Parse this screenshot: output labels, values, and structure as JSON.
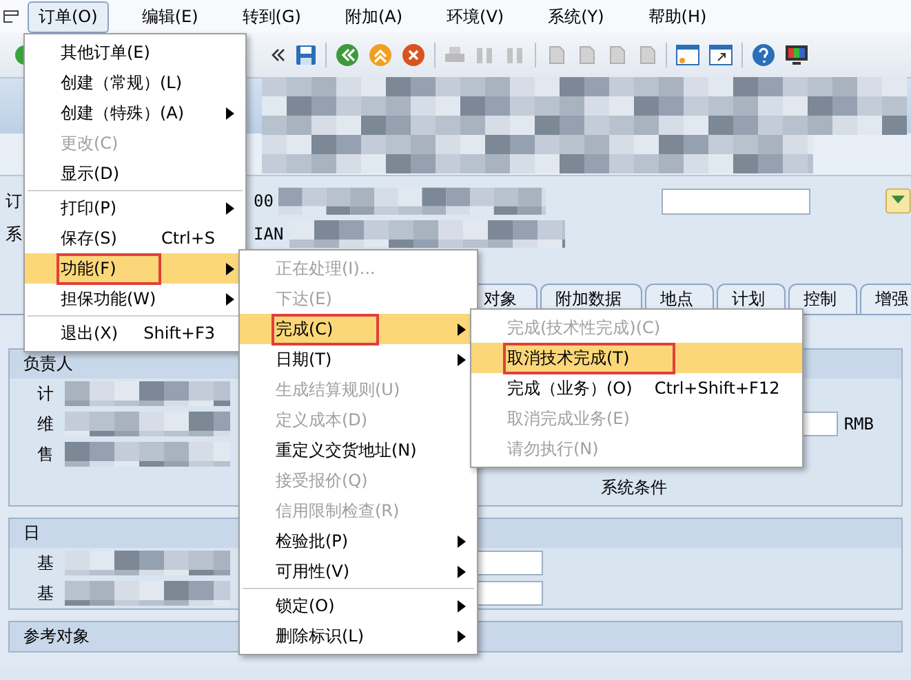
{
  "menubar": [
    {
      "label": "订单(O)",
      "selected": true
    },
    {
      "label": "编辑(E)",
      "selected": false
    },
    {
      "label": "转到(G)",
      "selected": false
    },
    {
      "label": "附加(A)",
      "selected": false
    },
    {
      "label": "环境(V)",
      "selected": false
    },
    {
      "label": "系统(Y)",
      "selected": false
    },
    {
      "label": "帮助(H)",
      "selected": false
    }
  ],
  "header_fields": [
    {
      "label": "订",
      "value": "00"
    },
    {
      "label": "系",
      "value": "IAN"
    }
  ],
  "tabs": [
    {
      "label": "对象",
      "selected": false
    },
    {
      "label": "附加数据",
      "selected": false
    },
    {
      "label": "地点",
      "selected": false
    },
    {
      "label": "计划",
      "selected": false
    },
    {
      "label": "控制",
      "selected": false
    },
    {
      "label": "增强",
      "selected": false
    }
  ],
  "groups": [
    {
      "title": "负责人",
      "rows": [
        "计",
        "维",
        "售"
      ]
    },
    {
      "title": "日",
      "rows": [
        "基",
        "基"
      ]
    },
    {
      "title": "参考对象"
    }
  ],
  "currency": "RMB",
  "status_label": "系统条件",
  "menus": [
    {
      "items": [
        {
          "kind": "item",
          "label": "其他订单(E)",
          "disabled": false,
          "selected": false,
          "submenu": false,
          "marked": false
        },
        {
          "kind": "item",
          "label": "创建（常规）(L)",
          "disabled": false,
          "selected": false,
          "submenu": false,
          "marked": false
        },
        {
          "kind": "item",
          "label": "创建（特殊）(A)",
          "disabled": false,
          "selected": false,
          "submenu": true,
          "marked": false
        },
        {
          "kind": "item",
          "label": "更改(C)",
          "disabled": true,
          "selected": false,
          "submenu": false,
          "marked": false
        },
        {
          "kind": "item",
          "label": "显示(D)",
          "disabled": false,
          "selected": false,
          "submenu": false,
          "marked": false
        },
        {
          "kind": "separator"
        },
        {
          "kind": "item",
          "label": "打印(P)",
          "disabled": false,
          "selected": false,
          "submenu": true,
          "marked": false
        },
        {
          "kind": "item",
          "label": "保存(S)",
          "shortcut": "Ctrl+S",
          "disabled": false,
          "selected": false,
          "submenu": false,
          "marked": false
        },
        {
          "kind": "item",
          "label": "功能(F)",
          "disabled": false,
          "selected": true,
          "submenu": true,
          "marked": true
        },
        {
          "kind": "item",
          "label": "担保功能(W)",
          "disabled": false,
          "selected": false,
          "submenu": true,
          "marked": false
        },
        {
          "kind": "separator"
        },
        {
          "kind": "item",
          "label": "退出(X)",
          "shortcut": "Shift+F3",
          "disabled": false,
          "selected": false,
          "submenu": false,
          "marked": false
        }
      ]
    },
    {
      "items": [
        {
          "kind": "item",
          "label": "正在处理(I)...",
          "disabled": true,
          "selected": false,
          "submenu": false,
          "marked": false
        },
        {
          "kind": "item",
          "label": "下达(E)",
          "disabled": true,
          "selected": false,
          "submenu": false,
          "marked": false
        },
        {
          "kind": "item",
          "label": "完成(C)",
          "disabled": false,
          "selected": true,
          "submenu": true,
          "marked": true
        },
        {
          "kind": "item",
          "label": "日期(T)",
          "disabled": false,
          "selected": false,
          "submenu": true,
          "marked": false
        },
        {
          "kind": "item",
          "label": "生成结算规则(U)",
          "disabled": true,
          "selected": false,
          "submenu": false,
          "marked": false
        },
        {
          "kind": "item",
          "label": "定义成本(D)",
          "disabled": true,
          "selected": false,
          "submenu": false,
          "marked": false
        },
        {
          "kind": "item",
          "label": "重定义交货地址(N)",
          "disabled": false,
          "selected": false,
          "submenu": false,
          "marked": false
        },
        {
          "kind": "item",
          "label": "接受报价(Q)",
          "disabled": true,
          "selected": false,
          "submenu": false,
          "marked": false
        },
        {
          "kind": "item",
          "label": "信用限制检查(R)",
          "disabled": true,
          "selected": false,
          "submenu": false,
          "marked": false
        },
        {
          "kind": "item",
          "label": "检验批(P)",
          "disabled": false,
          "selected": false,
          "submenu": true,
          "marked": false
        },
        {
          "kind": "item",
          "label": "可用性(V)",
          "disabled": false,
          "selected": false,
          "submenu": true,
          "marked": false
        },
        {
          "kind": "separator"
        },
        {
          "kind": "item",
          "label": "锁定(O)",
          "disabled": false,
          "selected": false,
          "submenu": true,
          "marked": false
        },
        {
          "kind": "item",
          "label": "删除标识(L)",
          "disabled": false,
          "selected": false,
          "submenu": true,
          "marked": false
        }
      ]
    },
    {
      "items": [
        {
          "kind": "item",
          "label": "完成(技术性完成)(C)",
          "disabled": true,
          "selected": false,
          "submenu": false,
          "marked": false
        },
        {
          "kind": "item",
          "label": "取消技术完成(T)",
          "disabled": false,
          "selected": true,
          "submenu": false,
          "marked": true
        },
        {
          "kind": "item",
          "label": "完成（业务）(O)",
          "shortcut": "Ctrl+Shift+F12",
          "disabled": false,
          "selected": false,
          "submenu": false,
          "marked": false
        },
        {
          "kind": "item",
          "label": "取消完成业务(E)",
          "disabled": true,
          "selected": false,
          "submenu": false,
          "marked": false
        },
        {
          "kind": "item",
          "label": "请勿执行(N)",
          "disabled": true,
          "selected": false,
          "submenu": false,
          "marked": false
        }
      ]
    }
  ]
}
